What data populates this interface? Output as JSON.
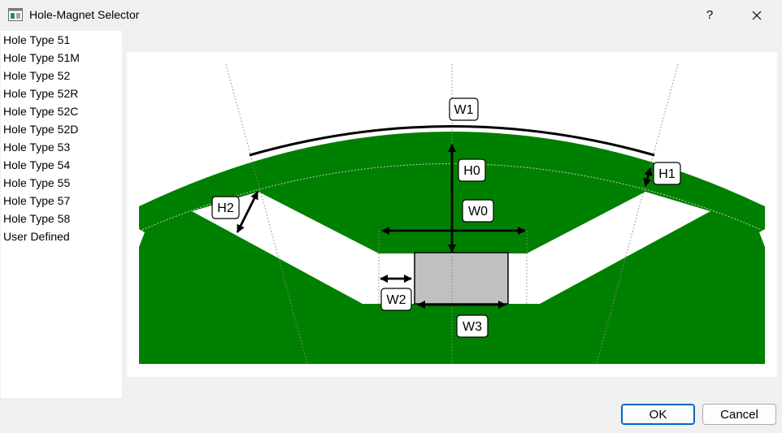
{
  "window": {
    "title": "Hole-Magnet Selector",
    "help_label": "?"
  },
  "hole_types": [
    "Hole Type 51",
    "Hole Type 51M",
    "Hole Type 52",
    "Hole Type 52R",
    "Hole Type 52C",
    "Hole Type 52D",
    "Hole Type 53",
    "Hole Type 54",
    "Hole Type 55",
    "Hole Type 57",
    "Hole Type 58",
    "User Defined"
  ],
  "diagram": {
    "labels": {
      "w1": "W1",
      "h0": "H0",
      "w0": "W0",
      "h1": "H1",
      "h2": "H2",
      "w2": "W2",
      "w3": "W3"
    },
    "colors": {
      "rotor": "#008000",
      "magnet": "#c0c0c0",
      "hole": "#ffffff"
    }
  },
  "buttons": {
    "ok": "OK",
    "cancel": "Cancel"
  }
}
